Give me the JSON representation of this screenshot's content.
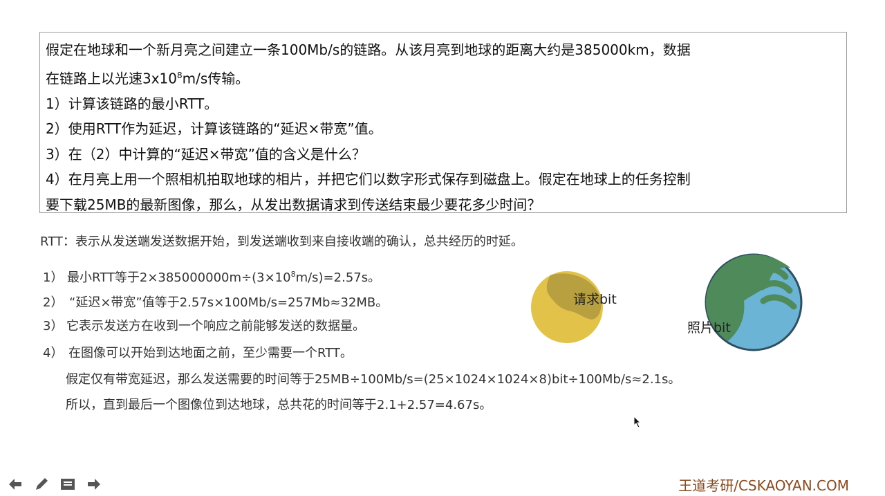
{
  "question": {
    "line1": "假定在地球和一个新月亮之间建立一条100Mb/s的链路。从该月亮到地球的距离大约是385000km，数据",
    "line2_pre": "在链路上以光速3x10",
    "line2_sup": "8",
    "line2_post": "m/s传输。",
    "line3": "1）计算该链路的最小RTT。",
    "line4": "2）使用RTT作为延迟，计算该链路的“延迟×带宽”值。",
    "line5": "3）在（2）中计算的“延迟×带宽”值的含义是什么？",
    "line6": "4）在月亮上用一个照相机拍取地球的相片，并把它们以数字形式保存到磁盘上。假定在地球上的任务控制",
    "line7": "要下载25MB的最新图像，那么，从发出数据请求到传送结束最少要花多少时间？"
  },
  "definition": "RTT：表示从发送端发送数据开始，到发送端收到来自接收端的确认，总共经历的时延。",
  "answers": {
    "a1_num": "1）",
    "a1_pre": "最小RTT等于2×385000000m÷(3×10",
    "a1_sup": "8",
    "a1_post": "m/s)=2.57s。",
    "a2_num": "2）",
    "a2_text": "“延迟×带宽”值等于2.57s×100Mb/s=257Mb≈32MB。",
    "a3_num": "3）",
    "a3_text": "它表示发送方在收到一个响应之前能够发送的数据量。",
    "a4_num": "4）",
    "a4_text": "在图像可以开始到达地面之前，至少需要一个RTT。",
    "a4_line2": "假定仅有带宽延迟，那么发送需要的时间等于25MB÷100Mb/s=(25×1024×1024×8)bit÷100Mb/s≈2.1s。",
    "a4_line3": "所以，直到最后一个图像位到达地球，总共花的时间等于2.1+2.57=4.67s。"
  },
  "diagram": {
    "request_label": "请求bit",
    "photo_label": "照片bit",
    "moon_color": "#e3c24a",
    "moon_shadow": "#b8a040",
    "earth_green": "#4f8a5a",
    "earth_blue": "#6cb4d6"
  },
  "toolbar": {
    "icons": [
      "arrow-left-icon",
      "pen-icon",
      "menu-icon",
      "arrow-right-icon"
    ]
  },
  "brand": "王道考研/CSKAOYAN.COM"
}
